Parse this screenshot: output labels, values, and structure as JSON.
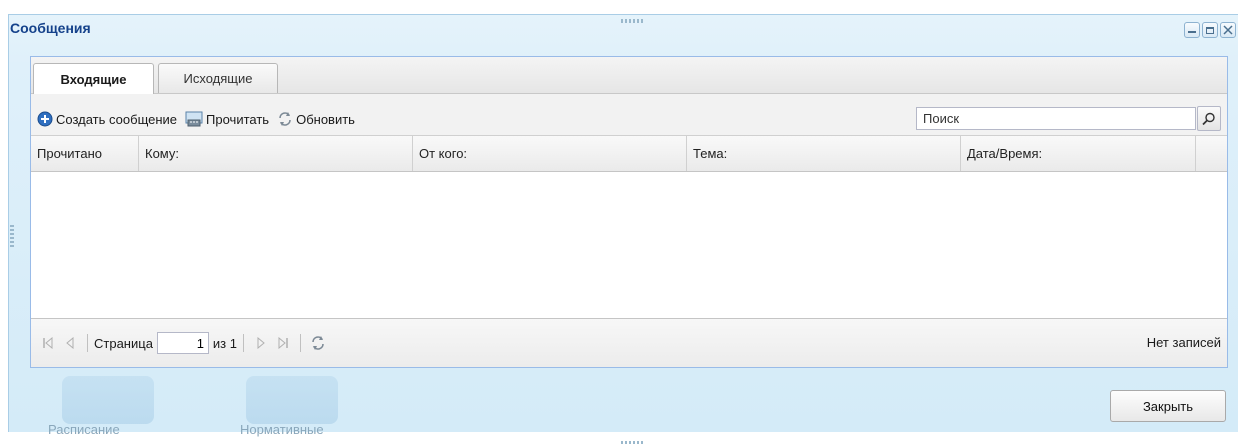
{
  "window": {
    "title": "Сообщения"
  },
  "tabs": [
    {
      "label": "Входящие",
      "active": true
    },
    {
      "label": "Исходящие",
      "active": false
    }
  ],
  "toolbar": {
    "create_label": "Создать сообщение",
    "read_label": "Прочитать",
    "refresh_label": "Обновить",
    "search_value": "Поиск"
  },
  "grid": {
    "columns": [
      "Прочитано",
      "Кому:",
      "От кого:",
      "Тема:",
      "Дата/Время:"
    ],
    "rows": []
  },
  "pager": {
    "page_label": "Страница",
    "current_page": "1",
    "of_label": "из 1",
    "status": "Нет записей"
  },
  "background": {
    "tile1": "Расписание",
    "tile2": "Нормативные"
  },
  "footer": {
    "close_label": "Закрыть"
  },
  "colors": {
    "window_bg": "#dff0fa",
    "title_color": "#15428b",
    "border": "#99bbe8"
  }
}
